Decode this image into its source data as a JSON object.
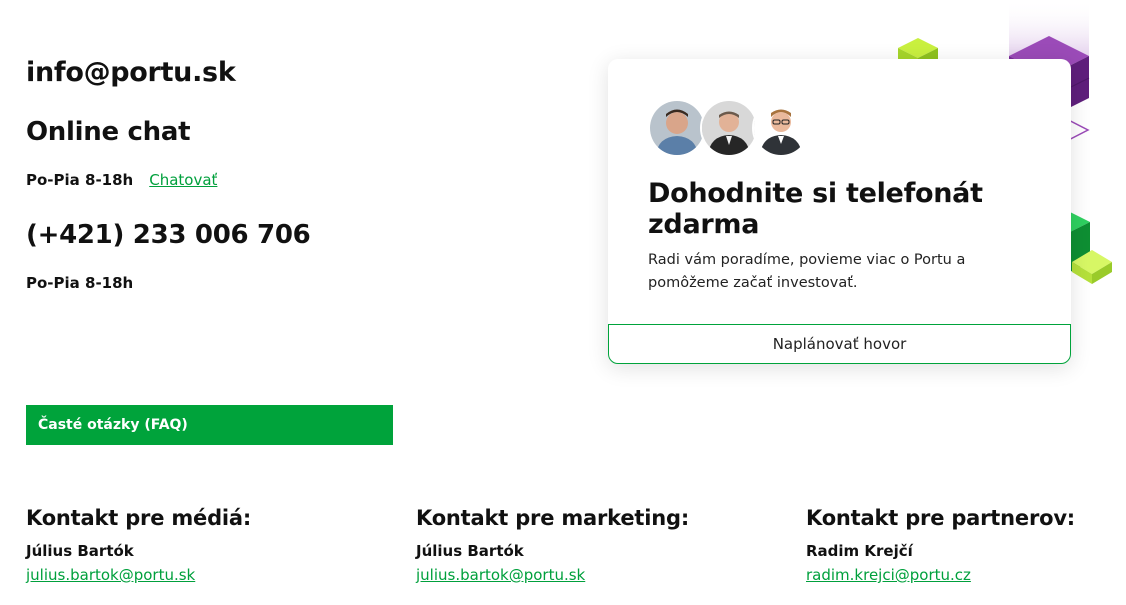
{
  "contact_email": "info@portu.sk",
  "chat": {
    "title": "Online chat",
    "hours": "Po-Pia 8-18h",
    "link_label": "Chatovať"
  },
  "phone": {
    "number": "(+421) 233 006 706",
    "hours": "Po-Pia 8-18h"
  },
  "faq_button": "Časté otázky (FAQ)",
  "call_card": {
    "title": "Dohodnite si telefonát zdarma",
    "text": "Radi vám poradíme, povieme viac o Portu a pomôžeme začať investovať.",
    "button": "Naplánovať hovor"
  },
  "contacts": [
    {
      "heading": "Kontakt pre médiá:",
      "name": "Július Bartók",
      "email": "julius.bartok@portu.sk"
    },
    {
      "heading": "Kontakt pre marketing:",
      "name": "Július Bartók",
      "email": "julius.bartok@portu.sk"
    },
    {
      "heading": "Kontakt pre partnerov:",
      "name": "Radim Krejčí",
      "email": "radim.krejci@portu.cz"
    }
  ],
  "colors": {
    "accent_green": "#00a33b",
    "link_green": "#00a03c",
    "purple": "#7a2c9a",
    "lime": "#b9e83a"
  }
}
